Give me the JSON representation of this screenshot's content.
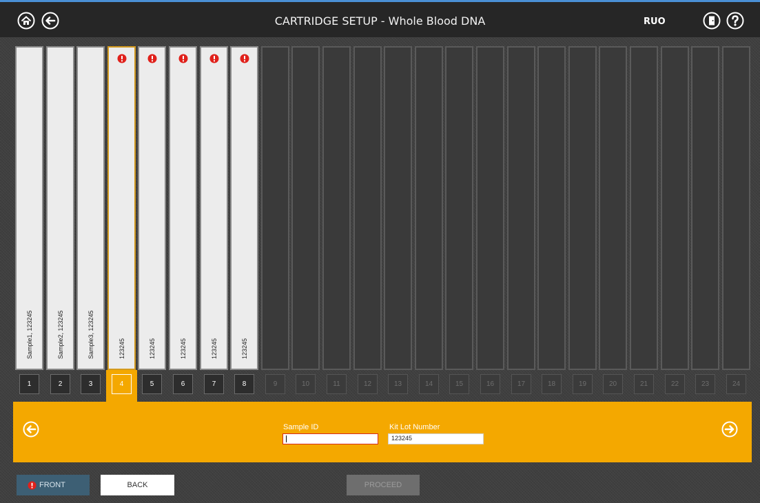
{
  "header": {
    "title": "CARTRIDGE SETUP - Whole Blood DNA",
    "badge": "RUO",
    "icons": [
      "home-icon",
      "back-arrow-icon",
      "exit-door-icon",
      "help-icon"
    ]
  },
  "slots": [
    {
      "number": "1",
      "label": "Sample1, 123245",
      "filled": true,
      "warning": false
    },
    {
      "number": "2",
      "label": "Sample2, 123245",
      "filled": true,
      "warning": false
    },
    {
      "number": "3",
      "label": "Sample3, 123245",
      "filled": true,
      "warning": false
    },
    {
      "number": "4",
      "label": "123245",
      "filled": true,
      "warning": true,
      "active": true
    },
    {
      "number": "5",
      "label": "123245",
      "filled": true,
      "warning": true
    },
    {
      "number": "6",
      "label": "123245",
      "filled": true,
      "warning": true
    },
    {
      "number": "7",
      "label": "123245",
      "filled": true,
      "warning": true
    },
    {
      "number": "8",
      "label": "123245",
      "filled": true,
      "warning": true
    },
    {
      "number": "9",
      "label": "",
      "filled": false,
      "warning": false
    },
    {
      "number": "10",
      "label": "",
      "filled": false,
      "warning": false
    },
    {
      "number": "11",
      "label": "",
      "filled": false,
      "warning": false
    },
    {
      "number": "12",
      "label": "",
      "filled": false,
      "warning": false
    },
    {
      "number": "13",
      "label": "",
      "filled": false,
      "warning": false
    },
    {
      "number": "14",
      "label": "",
      "filled": false,
      "warning": false
    },
    {
      "number": "15",
      "label": "",
      "filled": false,
      "warning": false
    },
    {
      "number": "16",
      "label": "",
      "filled": false,
      "warning": false
    },
    {
      "number": "17",
      "label": "",
      "filled": false,
      "warning": false
    },
    {
      "number": "18",
      "label": "",
      "filled": false,
      "warning": false
    },
    {
      "number": "19",
      "label": "",
      "filled": false,
      "warning": false
    },
    {
      "number": "20",
      "label": "",
      "filled": false,
      "warning": false
    },
    {
      "number": "21",
      "label": "",
      "filled": false,
      "warning": false
    },
    {
      "number": "22",
      "label": "",
      "filled": false,
      "warning": false
    },
    {
      "number": "23",
      "label": "",
      "filled": false,
      "warning": false
    },
    {
      "number": "24",
      "label": "",
      "filled": false,
      "warning": false
    }
  ],
  "panel": {
    "sample_id_label": "Sample ID",
    "sample_id_value": "",
    "kit_lot_label": "Kit Lot Number",
    "kit_lot_value": "123245"
  },
  "footer": {
    "front_label": "FRONT",
    "back_label": "BACK",
    "proceed_label": "PROCEED"
  },
  "colors": {
    "accent": "#f4a800",
    "warning": "#e0211b",
    "header_bg": "#262626"
  }
}
